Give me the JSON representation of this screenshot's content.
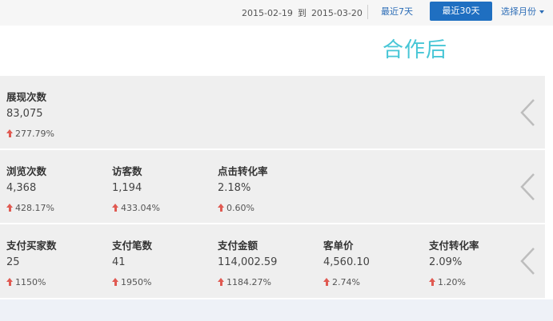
{
  "toolbar": {
    "date_start": "2015-02-19",
    "date_sep": "到",
    "date_end": "2015-03-20",
    "last7_label": "最近7天",
    "last30_label": "最近30天",
    "month_select_label": "选择月份"
  },
  "banner": {
    "title": "合作后"
  },
  "panels": [
    {
      "metrics": [
        {
          "label": "展现次数",
          "value": "83,075",
          "change": "277.79%"
        }
      ]
    },
    {
      "metrics": [
        {
          "label": "浏览次数",
          "value": "4,368",
          "change": "428.17%"
        },
        {
          "label": "访客数",
          "value": "1,194",
          "change": "433.04%"
        },
        {
          "label": "点击转化率",
          "value": "2.18%",
          "change": "0.60%"
        }
      ]
    },
    {
      "metrics": [
        {
          "label": "支付买家数",
          "value": "25",
          "change": "1150%"
        },
        {
          "label": "支付笔数",
          "value": "41",
          "change": "1950%"
        },
        {
          "label": "支付金额",
          "value": "114,002.59",
          "change": "1184.27%"
        },
        {
          "label": "客单价",
          "value": "4,560.10",
          "change": "2.74%"
        },
        {
          "label": "支付转化率",
          "value": "2.09%",
          "change": "1.20%"
        }
      ]
    }
  ],
  "icons": {
    "trend": "arrow-up-icon",
    "expand": "chevron-left-icon"
  },
  "colors": {
    "primary": "#1f6fc1",
    "link": "#2b6cb6",
    "banner_title": "#47c6d6",
    "up_arrow": "#e05a52",
    "panel_bg": "#efefef"
  }
}
